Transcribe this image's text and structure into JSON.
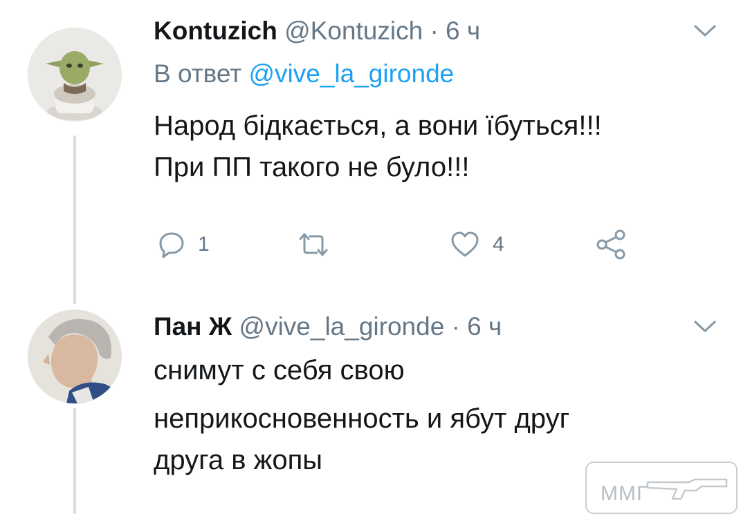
{
  "tweets": [
    {
      "name": "Kontuzich",
      "handle": "@Kontuzich",
      "separator": "·",
      "time": "6 ч",
      "reply_prefix": "В ответ",
      "reply_to": "@vive_la_gironde",
      "lines": [
        "Народ бідкається, а вони їбуться!!!",
        "При ПП такого не було!!!"
      ],
      "avatar_icon": "yoda-figurine-avatar"
    },
    {
      "name": "Пан Ж",
      "handle": "@vive_la_gironde",
      "separator": "·",
      "time": "6 ч",
      "lines": [
        "снимут с себя свою",
        "неприкосновенность и ябут друг",
        "друга в жопы"
      ],
      "avatar_icon": "portrait-avatar"
    }
  ],
  "actions": {
    "reply_count": "1",
    "retweet_count": "",
    "like_count": "4",
    "icons": [
      "reply-icon",
      "retweet-icon",
      "like-icon",
      "share-icon"
    ]
  },
  "watermark": {
    "text": "ММГ"
  },
  "colors": {
    "name": "#14171a",
    "secondary": "#657786",
    "link": "#1da1f2",
    "thread_line": "#d4dbe1"
  }
}
